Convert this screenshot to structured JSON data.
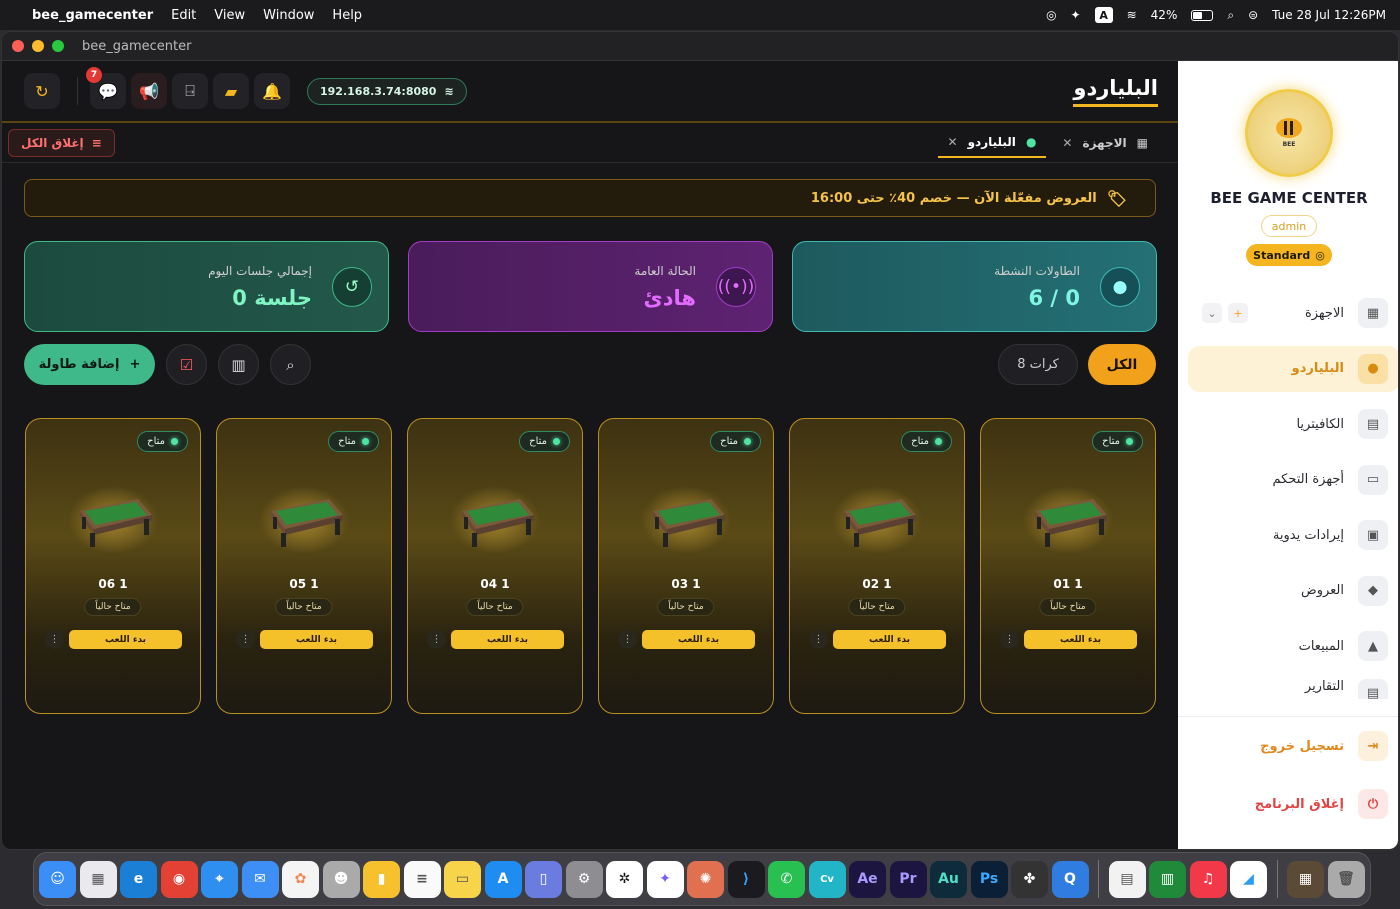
{
  "menubar": {
    "app": "bee_gamecenter",
    "items": [
      "Edit",
      "View",
      "Window",
      "Help"
    ],
    "battery": "42%",
    "datetime": "Tue 28 Jul  12:26PM"
  },
  "window": {
    "title": "bee_gamecenter"
  },
  "topbar": {
    "notifications_count": "7",
    "ip": "192.168.3.74:8080",
    "page_title": "البلياردو"
  },
  "tabsbar": {
    "close_all": "إغلاق الكل",
    "tabs": [
      {
        "label": "الاجهزة"
      },
      {
        "label": "البلياردو"
      }
    ]
  },
  "promo": {
    "text": "العروض مفعّلة الآن — خصم 40٪ حتى 16:00"
  },
  "stats": [
    {
      "label": "الطاولات النشطة",
      "value": "6 / 0"
    },
    {
      "label": "الحالة العامة",
      "value": "هادئ"
    },
    {
      "label": "إجمالي جلسات اليوم",
      "value": "0 جلسة"
    }
  ],
  "controls": {
    "add_table": "إضافة طاولة",
    "filter_all": "الكل",
    "filter_count": "8 كرات"
  },
  "cards": [
    {
      "number": "01 1",
      "status": "متاح",
      "availability": "متاح حالياً",
      "action": "بدء اللعب"
    },
    {
      "number": "02 1",
      "status": "متاح",
      "availability": "متاح حالياً",
      "action": "بدء اللعب"
    },
    {
      "number": "03 1",
      "status": "متاح",
      "availability": "متاح حالياً",
      "action": "بدء اللعب"
    },
    {
      "number": "04 1",
      "status": "متاح",
      "availability": "متاح حالياً",
      "action": "بدء اللعب"
    },
    {
      "number": "05 1",
      "status": "متاح",
      "availability": "متاح حالياً",
      "action": "بدء اللعب"
    },
    {
      "number": "06 1",
      "status": "متاح",
      "availability": "متاح حالياً",
      "action": "بدء اللعب"
    }
  ],
  "sidebar": {
    "logo_text": "BEE",
    "brand": "BEE GAME CENTER",
    "role": "admin",
    "plan": "Standard",
    "items": [
      {
        "label": "الاجهزة",
        "icon": "grid-icon"
      },
      {
        "label": "البلياردو",
        "icon": "billiard-icon"
      },
      {
        "label": "الكافيتريا",
        "icon": "cafeteria-icon"
      },
      {
        "label": "أجهزة التحكم",
        "icon": "gamepad-icon"
      },
      {
        "label": "إيرادات يدوية",
        "icon": "receipt-icon"
      },
      {
        "label": "العروض",
        "icon": "tag-icon"
      },
      {
        "label": "المبيعات",
        "icon": "sales-icon"
      },
      {
        "label": "التقارير",
        "icon": "report-icon"
      }
    ],
    "logout": "تسجيل خروج",
    "quit": "إغلاق البرنامج"
  },
  "colors": {
    "accent": "#f5b71f",
    "green": "#3fb98a",
    "purple": "#a13cc7"
  }
}
